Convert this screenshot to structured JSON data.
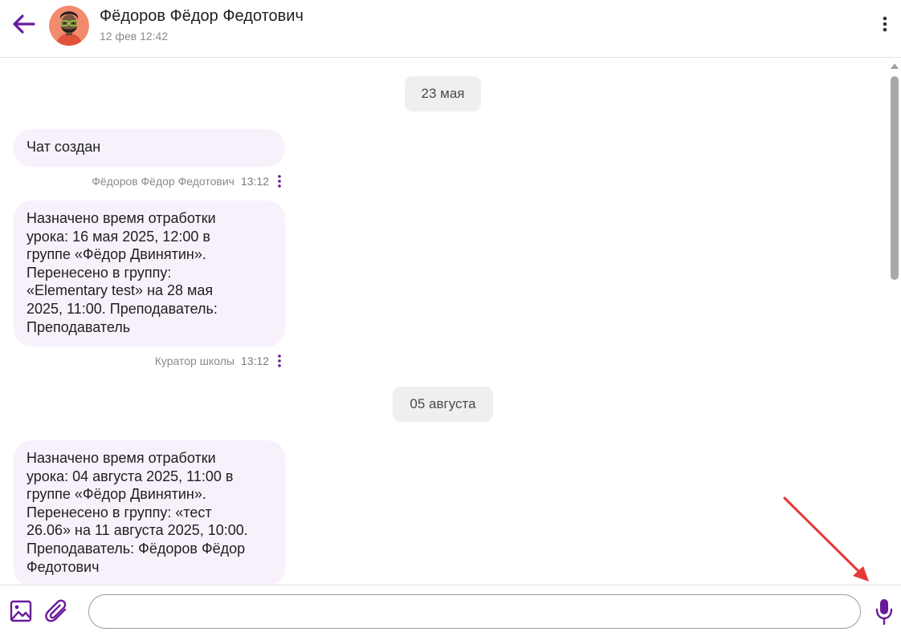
{
  "header": {
    "back_icon": "arrow-left-icon",
    "contact_name": "Фёдоров Фёдор Федотович",
    "contact_subtitle": "12 фев 12:42",
    "more_icon": "more-vertical-icon"
  },
  "messages": {
    "date_1": "23 мая",
    "msg_1": {
      "text": "Чат создан",
      "author": "Фёдоров Фёдор Федотович",
      "time": "13:12"
    },
    "msg_2": {
      "text": "Назначено время отработки\nурока: 16 мая 2025, 12:00 в\nгруппе «Фёдор Двинятин».\nПеренесено в группу:\n«Elementary test» на 28 мая\n2025, 11:00. Преподаватель:\nПреподаватель",
      "author": "Куратор школы",
      "time": "13:12"
    },
    "date_2": "05 августа",
    "msg_3": {
      "text": "Назначено время отработки\nурока: 04 августа 2025, 11:00 в\nгруппе «Фёдор Двинятин».\nПеренесено в группу: «тест\n26.06» на 11 августа 2025, 10:00.\nПреподаватель: Фёдоров Фёдор\nФедотович"
    }
  },
  "composer": {
    "image_icon": "image-icon",
    "attach_icon": "paperclip-icon",
    "input_value": "",
    "input_placeholder": "",
    "mic_icon": "microphone-icon"
  },
  "colors": {
    "accent": "#6a1b9a",
    "bubble_bg": "#f8f1fb",
    "date_chip_bg": "#efefef",
    "annotation_arrow": "#e53935"
  }
}
